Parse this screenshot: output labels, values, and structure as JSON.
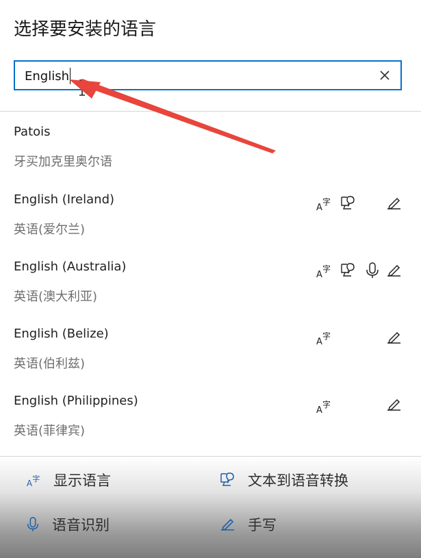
{
  "header": {
    "title": "选择要安装的语言"
  },
  "search": {
    "value": "English"
  },
  "languages": [
    {
      "name": "Patois",
      "native": "牙买加克里奥尔语",
      "features": []
    },
    {
      "name": "English (Ireland)",
      "native": "英语(爱尔兰)",
      "features": [
        "display-language",
        "text-to-speech",
        "handwriting"
      ]
    },
    {
      "name": "English (Australia)",
      "native": "英语(澳大利亚)",
      "features": [
        "display-language",
        "text-to-speech",
        "speech-recognition",
        "handwriting"
      ]
    },
    {
      "name": "English (Belize)",
      "native": "英语(伯利兹)",
      "features": [
        "display-language",
        "handwriting"
      ]
    },
    {
      "name": "English (Philippines)",
      "native": "英语(菲律宾)",
      "features": [
        "display-language",
        "handwriting"
      ]
    }
  ],
  "legend": {
    "display_language": "显示语言",
    "text_to_speech": "文本到语音转换",
    "speech_recognition": "语音识别",
    "handwriting": "手写"
  },
  "icons": [
    "display-language-icon",
    "text-to-speech-icon",
    "speech-recognition-icon",
    "handwriting-icon",
    "close-icon",
    "text-cursor-icon"
  ],
  "colors": {
    "accent": "#0a6fc7",
    "annotation_arrow": "#e8453c",
    "secondary_text": "#6e6e6e"
  }
}
